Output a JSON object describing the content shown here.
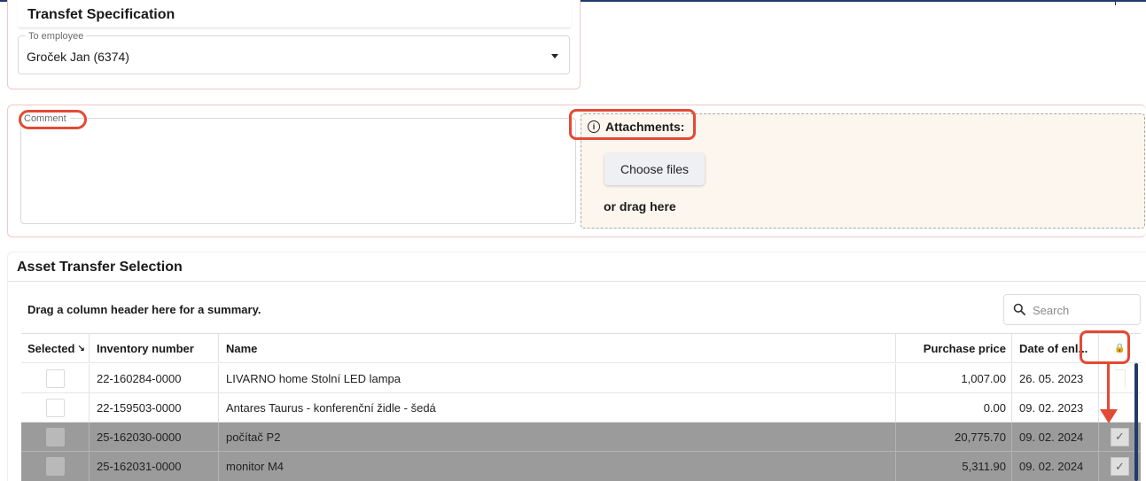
{
  "spec": {
    "title": "Transfet Specification",
    "employee_label": "To employee",
    "employee_value": "Groček Jan (6374)"
  },
  "comment": {
    "label": "Comment",
    "value": ""
  },
  "attachments": {
    "title": "Attachments:",
    "info_glyph": "i",
    "choose_label": "Choose files",
    "drag_label": "or drag here"
  },
  "selection": {
    "title": "Asset Transfer Selection",
    "group_hint": "Drag a column header here for a summary.",
    "search_placeholder": "Search",
    "columns": {
      "selected": "Selected",
      "inventory": "Inventory number",
      "name": "Name",
      "price": "Purchase price",
      "date": "Date of enl..."
    },
    "sort_glyph": "↘",
    "lock_glyph": "🔒",
    "check_glyph": "✓",
    "rows": [
      {
        "inventory": "22-160284-0000",
        "name": "LIVARNO home Stolní LED lampa",
        "price": "1,007.00",
        "date": "26. 05. 2023",
        "locked": false
      },
      {
        "inventory": "22-159503-0000",
        "name": "Antares Taurus - konferenční židle - šedá",
        "price": "0.00",
        "date": "09. 02. 2023",
        "locked": false
      },
      {
        "inventory": "25-162030-0000",
        "name": "počítač P2",
        "price": "20,775.70",
        "date": "09. 02. 2024",
        "locked": true
      },
      {
        "inventory": "25-162031-0000",
        "name": "monitor M4",
        "price": "5,311.90",
        "date": "09. 02. 2024",
        "locked": true
      }
    ]
  },
  "colors": {
    "highlight": "#e34a35",
    "dark_row": "#9b9b9b",
    "accent": "#1f3a6e",
    "attach_bg": "#fcf6ef"
  }
}
